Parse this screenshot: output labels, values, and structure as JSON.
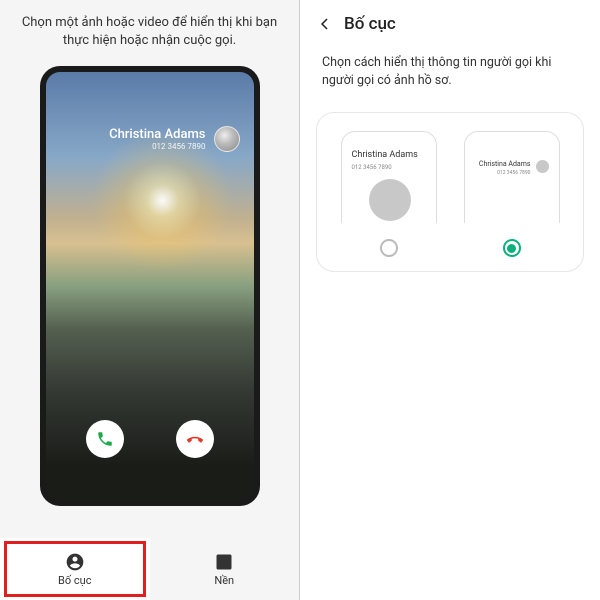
{
  "left": {
    "instruction": "Chọn một ảnh hoặc video để hiển thị khi bạn thực hiện hoặc nhận cuộc gọi.",
    "caller_name": "Christina Adams",
    "caller_number": "012 3456 7890",
    "tabs": {
      "layout": "Bố cục",
      "background": "Nền"
    }
  },
  "right": {
    "title": "Bố cục",
    "description": "Chọn cách hiển thị thông tin người gọi khi người gọi có ảnh hồ sơ.",
    "option_a": {
      "name": "Christina Adams",
      "number": "012 3456 7890"
    },
    "option_b": {
      "name": "Christina Adams",
      "number": "012 3456 7890"
    }
  }
}
